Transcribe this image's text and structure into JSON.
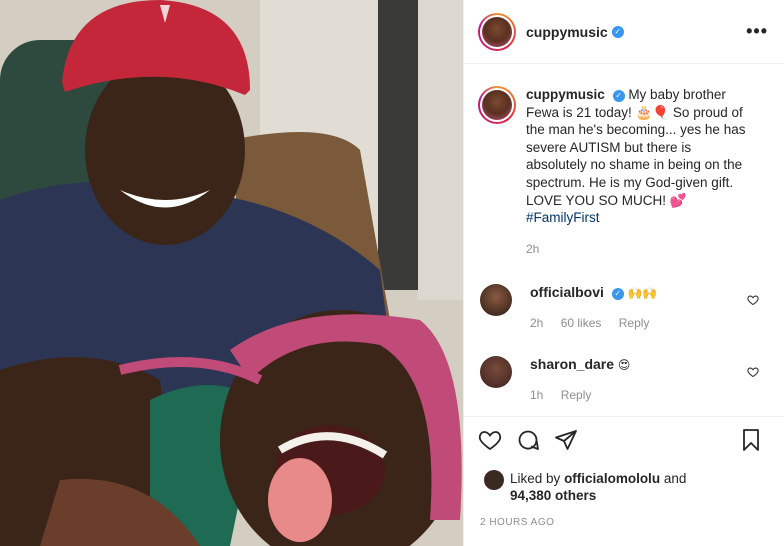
{
  "post": {
    "username": "cuppymusic",
    "verified_mark": "✓",
    "more_label": "•••",
    "caption_text": "My baby brother Fewa is 21 today! 🎂🎈 So proud of the man he's becoming... yes he has severe AUTISM but there is absolutely no shame in being on the spectrum. He is my God-given gift. LOVE YOU SO MUCH! 💕",
    "hashtag": "#FamilyFirst",
    "caption_time": "2h",
    "brand_color": "#3897f0"
  },
  "comments": [
    {
      "username": "officialbovi",
      "verified_mark": "✓",
      "text": "🙌🙌",
      "time": "2h",
      "likes": "60 likes",
      "reply": "Reply"
    },
    {
      "username": "sharon_dare",
      "text": "😍",
      "time": "1h",
      "reply": "Reply"
    }
  ],
  "footer": {
    "liked_by_prefix": "Liked by",
    "liked_by_user": "officialomololu",
    "and": "and",
    "others_count": "94,380 others",
    "date": "2 HOURS AGO"
  },
  "icons": {
    "like": "heart-icon",
    "comment": "comment-icon",
    "share": "paper-plane-icon",
    "save": "bookmark-icon",
    "more": "more-icon"
  }
}
